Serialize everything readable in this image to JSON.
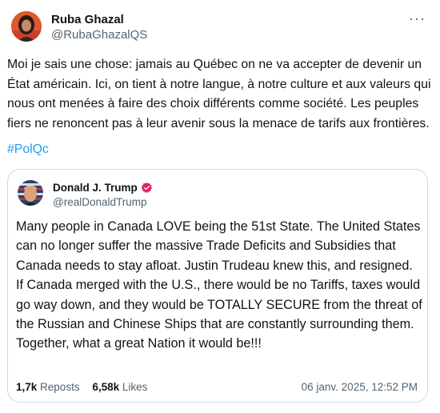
{
  "post": {
    "display_name": "Ruba Ghazal",
    "handle": "@RubaGhazalQS",
    "more_label": "···",
    "text": "Moi je sais une chose: jamais au Québec on ne va accepter de devenir un État américain. Ici, on tient à notre langue, à notre culture et aux valeurs qui nous ont menées à faire des choix différents comme société. Les peuples fiers ne renoncent pas à leur avenir sous la menace de tarifs aux frontières.",
    "hashtag": "#PolQc"
  },
  "quote": {
    "display_name": "Donald J. Trump",
    "handle": "@realDonaldTrump",
    "verified_icon": "verified-badge-icon",
    "text": "Many people in Canada LOVE being the 51st State. The United States can no longer suffer the massive Trade Deficits and Subsidies that Canada needs to stay afloat. Justin Trudeau knew this, and resigned. If Canada merged with the U.S., there would be no Tariffs, taxes would go way down, and they would be TOTALLY SECURE from the threat of the Russian and Chinese Ships that are constantly surrounding them. Together, what a great Nation it would be!!!",
    "reposts_count": "1,7k",
    "reposts_label": "Reposts",
    "likes_count": "6,58k",
    "likes_label": "Likes",
    "timestamp": "06 janv. 2025, 12:52 PM"
  },
  "colors": {
    "text": "#0f1419",
    "secondary": "#536471",
    "link": "#1d9bf0",
    "border": "#cfd9de",
    "verified": "#e0245e"
  }
}
